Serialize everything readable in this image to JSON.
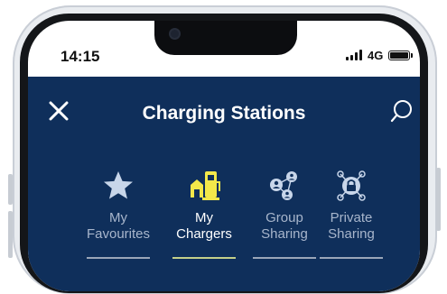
{
  "status_bar": {
    "time": "14:15",
    "network": "4G",
    "signal_icon": "cellular-signal-icon",
    "battery_icon": "battery-icon"
  },
  "header": {
    "title": "Charging Stations",
    "close_icon": "close-icon",
    "search_icon": "search-icon",
    "background_color": "#0f2f5b"
  },
  "tabs": [
    {
      "line1": "My",
      "line2": "Favourites",
      "icon": "star-icon",
      "active": false
    },
    {
      "line1": "My",
      "line2": "Chargers",
      "icon": "charger-station-icon",
      "active": true
    },
    {
      "line1": "Group",
      "line2": "Sharing",
      "icon": "group-sharing-icon",
      "active": false
    },
    {
      "line1": "Private",
      "line2": "Sharing",
      "icon": "private-sharing-icon",
      "active": false
    }
  ],
  "colors": {
    "active_icon": "#f3e84a",
    "inactive_icon": "#c8d6ea",
    "active_label": "#ffffff",
    "inactive_label": "#a8b6cc"
  }
}
